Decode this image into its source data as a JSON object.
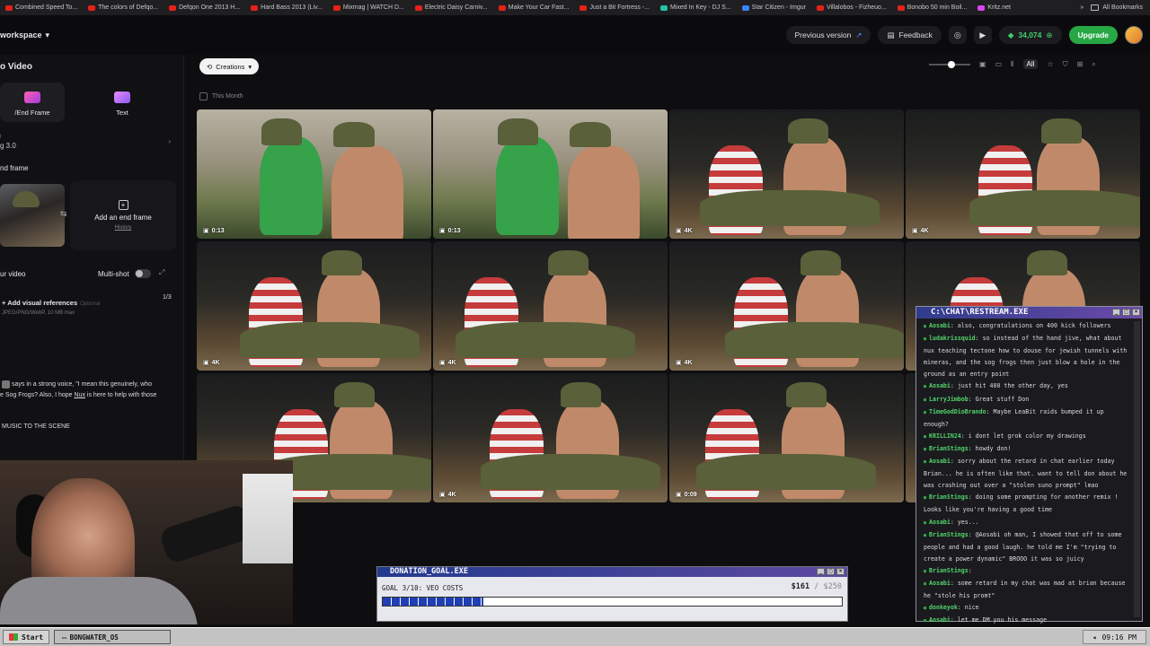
{
  "bookmarks": [
    {
      "label": "Combined Speed To..."
    },
    {
      "label": "The colors of Defqo..."
    },
    {
      "label": "Defqon One 2013 H..."
    },
    {
      "label": "Hard Bass 2013 (Liv..."
    },
    {
      "label": "Mixmag | WATCH D..."
    },
    {
      "label": "Electric Daisy Carniv..."
    },
    {
      "label": "Make Your Car Fast..."
    },
    {
      "label": "Just a Bit Fortress -..."
    },
    {
      "label": "Mixed In Key - DJ S..."
    },
    {
      "label": "Star Citizen - Imgur"
    },
    {
      "label": "Villalobos - Fizheuo..."
    },
    {
      "label": "Bonobo 50 min Boil..."
    },
    {
      "label": "Kritz.net"
    }
  ],
  "bookmarks_all": "All Bookmarks",
  "topbar": {
    "workspace": "workspace",
    "previous_version": "Previous version",
    "feedback": "Feedback",
    "credits": "34,074",
    "upgrade": "Upgrade"
  },
  "left": {
    "title": "o Video",
    "mode_frame": "/End Frame",
    "mode_text": "Text",
    "model": "g 3.0",
    "frame_section": "nd frame",
    "add_end_frame": "Add an end frame",
    "history": "History",
    "your_video": "ur video",
    "multi_shot": "Multi-shot",
    "visual_refs": "Add visual references",
    "visual_refs_optional": "Optional",
    "visual_refs_sub": "JPEG/PNG/WebP, 10 MB max",
    "count": "1/3",
    "prompt_a": "says in a strong voice, \"I mean this genuinely, who",
    "prompt_b": "e Sog Frogs? Also, I hope ",
    "prompt_nux": "Nux",
    "prompt_c": " is here to help with those",
    "music": "MUSIC TO THE SCENE"
  },
  "filters": {
    "creations": "Creations",
    "this_month": "This Month",
    "all": "All",
    "zoom_fraction": 0.55
  },
  "tiles": [
    {
      "badge": "0:13",
      "kind": "tent"
    },
    {
      "badge": "0:13",
      "kind": "tent"
    },
    {
      "badge": "4K",
      "kind": "dark"
    },
    {
      "badge": "4K",
      "kind": "dark"
    },
    {
      "badge": "4K",
      "kind": "dark"
    },
    {
      "badge": "4K",
      "kind": "dark"
    },
    {
      "badge": "4K",
      "kind": "dark"
    },
    {
      "badge": "",
      "kind": "dark"
    },
    {
      "badge": "",
      "kind": "dark"
    },
    {
      "badge": "4K",
      "kind": "dark"
    },
    {
      "badge": "0:09",
      "kind": "dark"
    },
    {
      "badge": "",
      "kind": "dark"
    }
  ],
  "chat": {
    "title": "C:\\CHAT\\RESTREAM.EXE",
    "messages": [
      {
        "user": "Aosabi",
        "text": "also, congratulations on 400 kick followers"
      },
      {
        "user": "ludakrissquid",
        "text": "so instead of the hand jive, what about nux teaching tectone how to douse for jewish tunnels with mineras, and the sog frogs then just blow a hole in the ground as an entry point"
      },
      {
        "user": "Aosabi",
        "text": "just hit 400 the other day, yes"
      },
      {
        "user": "LarryJimbob",
        "text": "Great stuff Don"
      },
      {
        "user": "TimeGodDioBrando",
        "text": "Maybe LeaBit raids bumped it up enough?"
      },
      {
        "user": "KRILLIN24",
        "text": "i dont let grok color my drawings"
      },
      {
        "user": "BrianStings",
        "text": "howdy don!"
      },
      {
        "user": "Aosabi",
        "text": "sorry about the retard in chat earlier today Brian... he is often like that. want to tell don about he was crashing out over a \"stolen suno prompt\" lmao"
      },
      {
        "user": "BrianStings",
        "text": "doing some prompting for another remix ! Looks like you're having a good time"
      },
      {
        "user": "Aosabi",
        "text": "yes..."
      },
      {
        "user": "BrianStings",
        "text": "@Aosabi oh man, I showed that off to some people and had a good laugh. he told me I'm \"trying to create a power dynamic\" BROOO it was so juicy"
      },
      {
        "user": "BrianStings",
        "text": ""
      },
      {
        "user": "Aosabi",
        "text": "some retard in my chat was mad at brian because he \"stole his promt\""
      },
      {
        "user": "donkeyok",
        "text": "nice"
      },
      {
        "user": "Aosabi",
        "text": "let me DM you his message"
      }
    ]
  },
  "donation": {
    "title": "DONATION_GOAL.EXE",
    "goal": "GOAL 3/10: VEO COSTS",
    "raised": "$161",
    "target": "$250",
    "progress": 0.22
  },
  "taskbar": {
    "start": "Start",
    "item": "BONGWATER_OS",
    "clock": "09:16 PM"
  }
}
